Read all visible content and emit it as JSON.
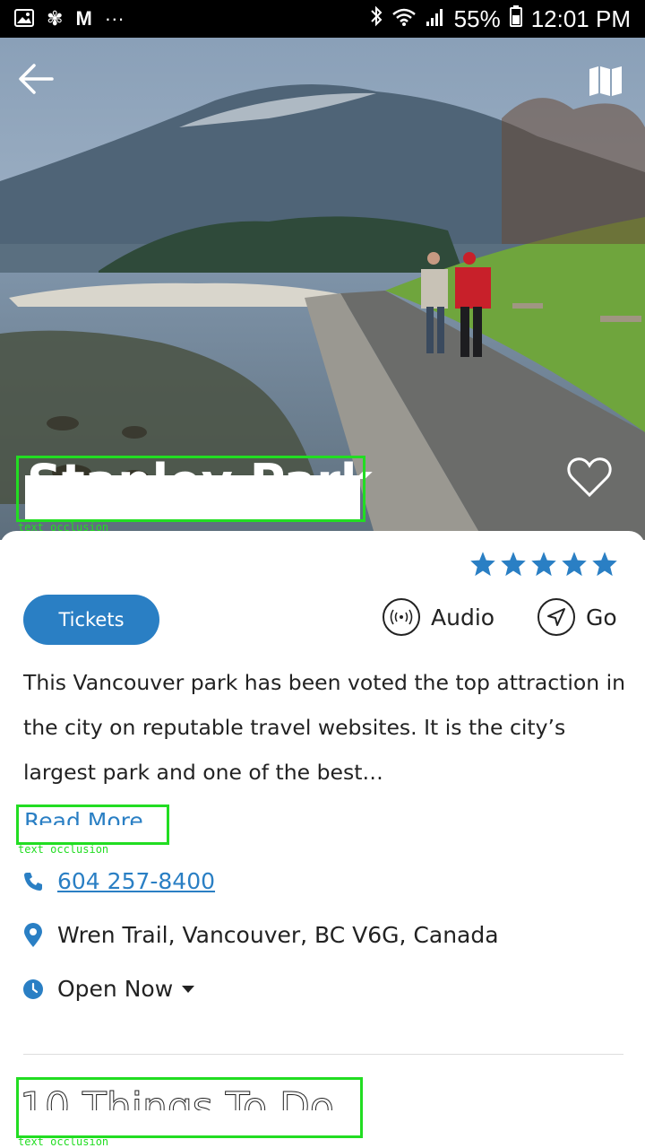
{
  "status_bar": {
    "left_icons": [
      "image-icon",
      "pinwheel-icon",
      "gmail-icon",
      "more-dots-icon"
    ],
    "battery": "55%",
    "time": "12:01 PM"
  },
  "hero": {
    "title": "Stanley Park",
    "occlusion_label": "text occlusion"
  },
  "rating": {
    "stars": 5
  },
  "actions": {
    "tickets_label": "Tickets",
    "audio_label": "Audio",
    "go_label": "Go"
  },
  "description": {
    "text": "This Vancouver park has been voted the top attraction in the city on reputable travel websites. It is the city’s largest park and one of the best…",
    "read_more_label": "Read More",
    "occlusion_label": "text occlusion"
  },
  "info": {
    "phone": "604 257-8400",
    "address": "Wren Trail, Vancouver, BC V6G, Canada",
    "hours": "Open Now"
  },
  "section": {
    "title": "10 Things To Do",
    "occlusion_label": "text occlusion"
  },
  "colors": {
    "accent": "#2a7fc4",
    "occlusion_box": "#22dd22"
  }
}
